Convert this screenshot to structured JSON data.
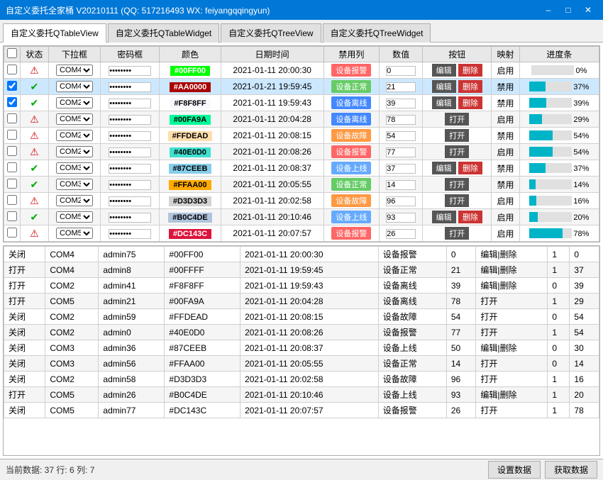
{
  "window": {
    "title": "自定义委托全家桶 V20210111 (QQ: 517216493 WX: feiyangqqingyun)"
  },
  "tabs": [
    {
      "label": "自定义委托QTableView",
      "active": true
    },
    {
      "label": "自定义委托QTableWidget",
      "active": false
    },
    {
      "label": "自定义委托QTreeView",
      "active": false
    },
    {
      "label": "自定义委托QTreeWidget",
      "active": false
    }
  ],
  "upper_table": {
    "headers": [
      "",
      "状态",
      "下拉框",
      "密码框",
      "颜色",
      "日期时间",
      "禁用列",
      "数值",
      "按钮",
      "映射",
      "进度条"
    ],
    "rows": [
      {
        "checked": false,
        "status": "err",
        "combo": "COM4",
        "pwd": "••••••••",
        "color": "#00FF00",
        "colorBg": "#00FF00",
        "datetime": "2021-01-11 20:00:30",
        "forbidden": "设备报警",
        "forbiddenBg": "#ff6666",
        "value": "0",
        "hasEditDelete": true,
        "mapVal": "启用",
        "progress": 0
      },
      {
        "checked": true,
        "status": "ok",
        "combo": "COM4",
        "pwd": "•••••••",
        "color": "#AA0000",
        "colorBg": "#AA0000",
        "datetime": "2021-01-21 19:59:45",
        "forbidden": "设备正常",
        "forbiddenBg": "#66cc66",
        "value": "21",
        "hasEditDelete": true,
        "mapVal": "禁用",
        "progress": 37
      },
      {
        "checked": true,
        "status": "ok",
        "combo": "COM2",
        "pwd": "••••••••",
        "color": "#F8F8FF",
        "colorBg": "#F8F8FF",
        "datetime": "2021-01-11 19:59:43",
        "forbidden": "设备离线",
        "forbiddenBg": "#4488ff",
        "value": "39",
        "hasEditDelete": true,
        "mapVal": "禁用",
        "progress": 39
      },
      {
        "checked": false,
        "status": "err",
        "combo": "COM5",
        "pwd": "•••••••",
        "color": "#00FA9A",
        "colorBg": "#00FA9A",
        "datetime": "2021-01-11 20:04:28",
        "forbidden": "设备离线",
        "forbiddenBg": "#4488ff",
        "value": "78",
        "hasEditDelete": false,
        "mapVal": "启用",
        "progress": 29
      },
      {
        "checked": false,
        "status": "err",
        "combo": "COM2",
        "pwd": "••••••",
        "color": "#FFDEAD",
        "colorBg": "#FFDEAD",
        "datetime": "2021-01-11 20:08:15",
        "forbidden": "设备故障",
        "forbiddenBg": "#ff9944",
        "value": "54",
        "hasEditDelete": false,
        "mapVal": "禁用",
        "progress": 54
      },
      {
        "checked": false,
        "status": "err",
        "combo": "COM2",
        "pwd": "•••••",
        "color": "#40E0D0",
        "colorBg": "#40E0D0",
        "datetime": "2021-01-11 20:08:26",
        "forbidden": "设备报警",
        "forbiddenBg": "#ff6666",
        "value": "77",
        "hasEditDelete": false,
        "mapVal": "启用",
        "progress": 54
      },
      {
        "checked": false,
        "status": "ok",
        "combo": "COM3",
        "pwd": "•••••••",
        "color": "#87CEEB",
        "colorBg": "#87CEEB",
        "datetime": "2021-01-11 20:08:37",
        "forbidden": "设备上线",
        "forbiddenBg": "#66aaff",
        "value": "37",
        "hasEditDelete": true,
        "mapVal": "禁用",
        "progress": 37
      },
      {
        "checked": false,
        "status": "ok",
        "combo": "COM3",
        "pwd": "•••••••",
        "color": "#FFAA00",
        "colorBg": "#FFAA00",
        "datetime": "2021-01-11 20:05:55",
        "forbidden": "设备正常",
        "forbiddenBg": "#66cc66",
        "value": "14",
        "hasEditDelete": false,
        "mapVal": "禁用",
        "progress": 14
      },
      {
        "checked": false,
        "status": "err",
        "combo": "COM2",
        "pwd": "•••••••",
        "color": "#D3D3D3",
        "colorBg": "#D3D3D3",
        "datetime": "2021-01-11 20:02:58",
        "forbidden": "设备故障",
        "forbiddenBg": "#ff9944",
        "value": "96",
        "hasEditDelete": false,
        "mapVal": "启用",
        "progress": 16
      },
      {
        "checked": false,
        "status": "ok",
        "combo": "COM5",
        "pwd": "••••••",
        "color": "#B0C4DE",
        "colorBg": "#B0C4DE",
        "datetime": "2021-01-11 20:10:46",
        "forbidden": "设备上线",
        "forbiddenBg": "#66aaff",
        "value": "93",
        "hasEditDelete": true,
        "mapVal": "启用",
        "progress": 20
      },
      {
        "checked": false,
        "status": "err",
        "combo": "COM5",
        "pwd": "•••••••",
        "color": "#DC143C",
        "colorBg": "#DC143C",
        "datetime": "2021-01-11 20:07:57",
        "forbidden": "设备报警",
        "forbiddenBg": "#ff6666",
        "value": "26",
        "hasEditDelete": false,
        "mapVal": "启用",
        "progress": 78
      }
    ]
  },
  "lower_table": {
    "rows": [
      [
        "关闭",
        "COM4",
        "admin75",
        "#00FF00",
        "2021-01-11 20:00:30",
        "设备报警",
        "0",
        "编辑|删除",
        "1",
        "0"
      ],
      [
        "打开",
        "COM4",
        "admin8",
        "#00FFFF",
        "2021-01-11 19:59:45",
        "设备正常",
        "21",
        "编辑|删除",
        "1",
        "37"
      ],
      [
        "打开",
        "COM2",
        "admin41",
        "#F8F8FF",
        "2021-01-11 19:59:43",
        "设备离线",
        "39",
        "编辑|删除",
        "0",
        "39"
      ],
      [
        "打开",
        "COM5",
        "admin21",
        "#00FA9A",
        "2021-01-11 20:04:28",
        "设备离线",
        "78",
        "打开",
        "1",
        "29"
      ],
      [
        "关闭",
        "COM2",
        "admin59",
        "#FFDEAD",
        "2021-01-11 20:08:15",
        "设备故障",
        "54",
        "打开",
        "0",
        "54"
      ],
      [
        "关闭",
        "COM2",
        "admin0",
        "#40E0D0",
        "2021-01-11 20:08:26",
        "设备报警",
        "77",
        "打开",
        "1",
        "54"
      ],
      [
        "关闭",
        "COM3",
        "admin36",
        "#87CEEB",
        "2021-01-11 20:08:37",
        "设备上线",
        "50",
        "编辑|删除",
        "0",
        "30"
      ],
      [
        "关闭",
        "COM3",
        "admin56",
        "#FFAA00",
        "2021-01-11 20:05:55",
        "设备正常",
        "14",
        "打开",
        "0",
        "14"
      ],
      [
        "关闭",
        "COM2",
        "admin58",
        "#D3D3D3",
        "2021-01-11 20:02:58",
        "设备故障",
        "96",
        "打开",
        "1",
        "16"
      ],
      [
        "打开",
        "COM5",
        "admin26",
        "#B0C4DE",
        "2021-01-11 20:10:46",
        "设备上线",
        "93",
        "编辑|删除",
        "1",
        "20"
      ],
      [
        "关闭",
        "COM5",
        "admin77",
        "#DC143C",
        "2021-01-11 20:07:57",
        "设备报警",
        "26",
        "打开",
        "1",
        "78"
      ]
    ]
  },
  "status_bar": {
    "text": "当前数据: 37  行: 6  列: 7",
    "btn_set": "设置数据",
    "btn_get": "获取数据"
  },
  "colors": {
    "accent": "#0078d7",
    "progress": "#00b4c8"
  }
}
